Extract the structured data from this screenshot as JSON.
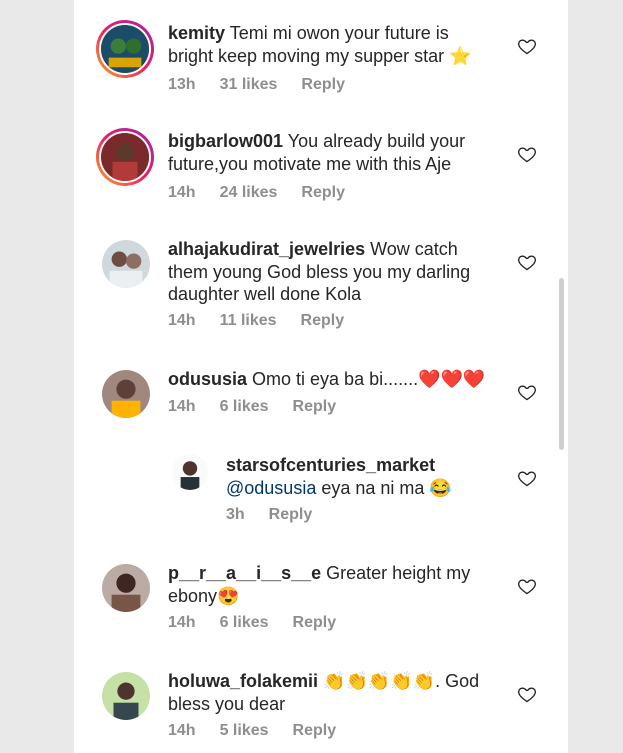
{
  "comments": [
    {
      "username": "kemity",
      "text": "Temi mi owon your future is bright keep moving my supper star",
      "emoji": "⭐",
      "time": "13h",
      "likes": "31 likes",
      "reply": "Reply"
    },
    {
      "username": "bigbarlow001",
      "text": "You already build your future,you motivate me with this Aje",
      "emoji": "",
      "time": "14h",
      "likes": "24 likes",
      "reply": "Reply"
    },
    {
      "username": "alhajakudirat_jewelries",
      "text": "Wow catch them young God bless you my darling daughter well done Kola",
      "emoji": "",
      "time": "14h",
      "likes": "11 likes",
      "reply": "Reply"
    },
    {
      "username": "odususia",
      "text": "Omo ti eya ba bi.......",
      "emoji": "❤️❤️❤️",
      "time": "14h",
      "likes": "6 likes",
      "reply": "Reply"
    },
    {
      "username": "starsofcenturies_market",
      "mention": "@odususia",
      "text": "eya na ni ma",
      "emoji": "😂",
      "time": "3h",
      "likes": "",
      "reply": "Reply"
    },
    {
      "username": "p__r__a__i__s__e",
      "text": "Greater height my ebony",
      "emoji": "😍",
      "time": "14h",
      "likes": "6 likes",
      "reply": "Reply"
    },
    {
      "username": "holuwa_folakemii",
      "emojis_before": "👏👏👏👏👏",
      "text": ". God bless you dear",
      "emoji": "",
      "time": "14h",
      "likes": "5 likes",
      "reply": "Reply"
    }
  ],
  "icons": {
    "like": "heart-outline-icon"
  },
  "colors": {
    "text": "#262626",
    "meta": "#8e8e8e",
    "mention": "#00376b"
  }
}
